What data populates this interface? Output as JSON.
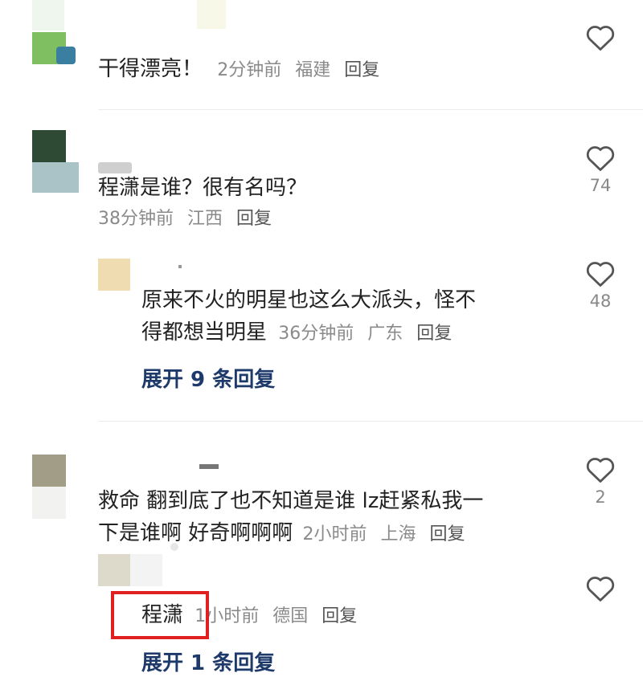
{
  "comments": [
    {
      "text": "干得漂亮！",
      "time": "2分钟前",
      "location": "福建",
      "reply_label": "回复",
      "likes": ""
    },
    {
      "text": "程潇是谁？很有名吗？",
      "time": "38分钟前",
      "location": "江西",
      "reply_label": "回复",
      "likes": "74",
      "replies": [
        {
          "text_line1": "原来不火的明星也这么大派头，怪不",
          "text_line2": "得都想当明星",
          "time": "36分钟前",
          "location": "广东",
          "reply_label": "回复",
          "likes": "48"
        }
      ],
      "expand_label": "展开 9 条回复"
    },
    {
      "text_line1": "救命 翻到底了也不知道是谁 lz赶紧私我一",
      "text_line2": "下是谁啊 好奇啊啊啊",
      "time": "2小时前",
      "location": "上海",
      "reply_label": "回复",
      "likes": "2",
      "replies": [
        {
          "text": "程潇",
          "time": "1小时前",
          "location": "德国",
          "reply_label": "回复",
          "likes": ""
        }
      ],
      "expand_label": "展开 1 条回复"
    }
  ],
  "colors": {
    "highlight": "#e02020",
    "expand_link": "#1e3a6b",
    "meta": "#8a8a8a"
  },
  "icons": {
    "like": "heart-outline-icon"
  }
}
